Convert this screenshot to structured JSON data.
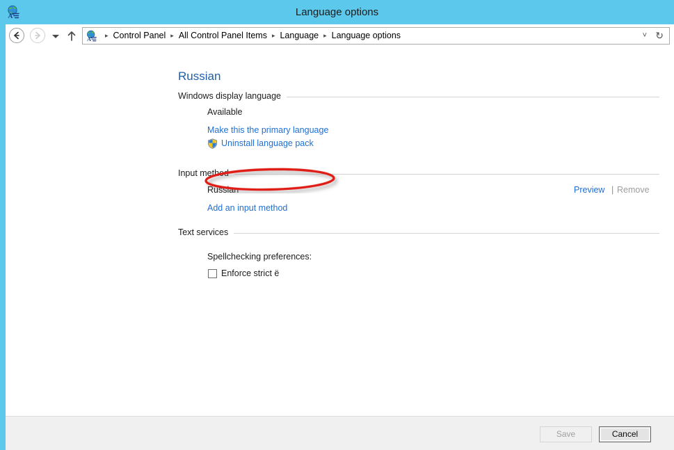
{
  "window": {
    "title": "Language options",
    "icon": "language-globe-icon",
    "frame_color": "#5bc8ec"
  },
  "navbar": {
    "back_icon": "back-arrow-icon",
    "forward_icon": "forward-arrow-icon",
    "recent_icon": "chevron-down-icon",
    "up_icon": "up-arrow-icon",
    "address_icon": "language-globe-icon",
    "breadcrumb": [
      "Control Panel",
      "All Control Panel Items",
      "Language",
      "Language options"
    ],
    "separator": "▸",
    "chevron_icon": "˅",
    "refresh_icon": "↻"
  },
  "main": {
    "page_title": "Russian",
    "sections": {
      "display": {
        "label": "Windows display language",
        "status": "Available",
        "make_primary_link": "Make this the primary language",
        "uninstall_link": "Uninstall language pack",
        "uninstall_icon": "uac-shield-icon"
      },
      "input": {
        "label": "Input method",
        "method_name": "Russian",
        "preview_link": "Preview",
        "separator": "|",
        "remove_link": "Remove",
        "remove_disabled": true,
        "add_link": "Add an input method"
      },
      "text_services": {
        "label": "Text services",
        "spellcheck_label": "Spellchecking preferences:",
        "enforce_label": "Enforce strict ё",
        "enforce_checked": false
      }
    }
  },
  "annotation": {
    "shape": "ellipse",
    "color": "#e01b18",
    "targets": "Make this the primary language"
  },
  "footer": {
    "save_label": "Save",
    "save_disabled": true,
    "cancel_label": "Cancel"
  },
  "colors": {
    "title_bar": "#5bc8ec",
    "link": "#1f6fd0",
    "heading": "#1f5fa9",
    "disabled": "#9d9d9d",
    "annotation": "#e01b18"
  }
}
